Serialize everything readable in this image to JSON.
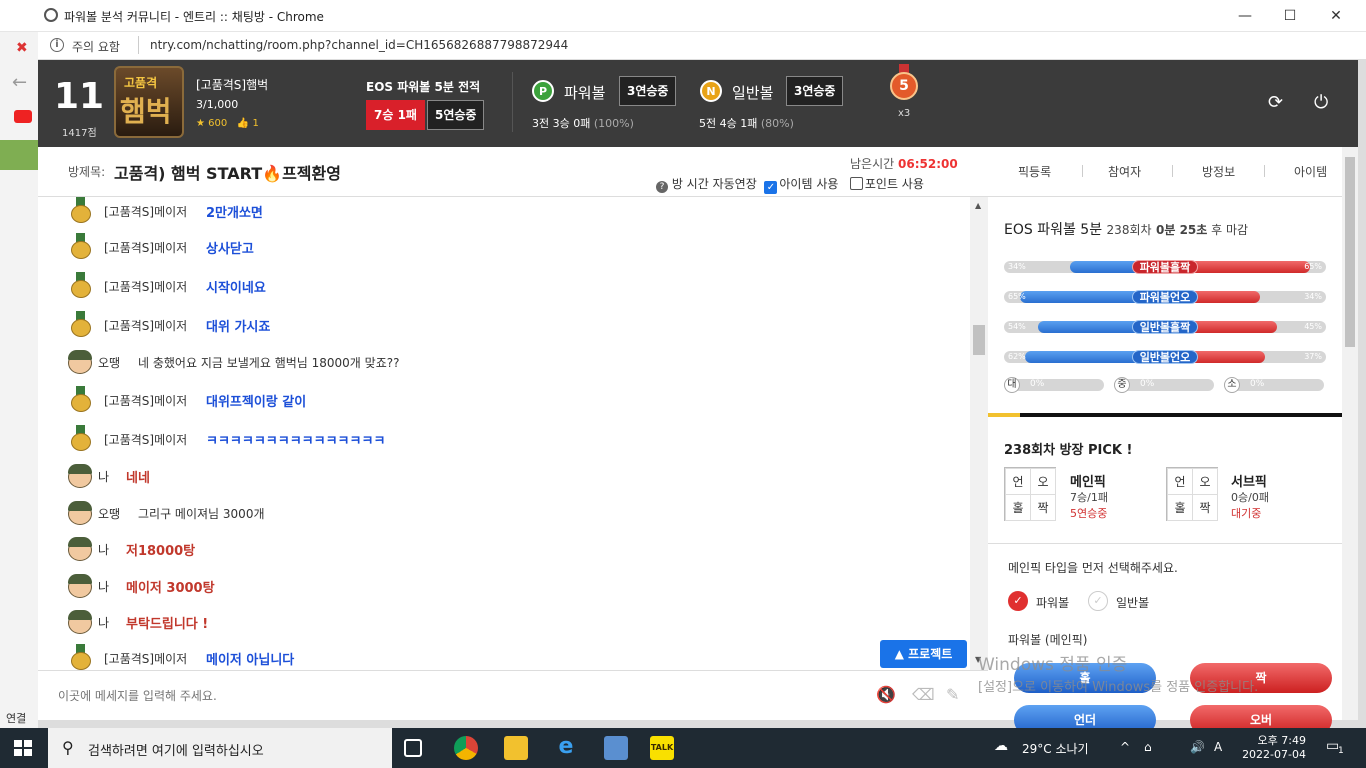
{
  "window": {
    "title": "파워볼 분석 커뮤니티 - 엔트리 :: 채팅방 - Chrome",
    "minimize": "—",
    "maximize": "☐",
    "close": "✕"
  },
  "address": {
    "warning": "주의 요함",
    "url": "ntry.com/nchatting/room.php?channel_id=CH1656826887798872944"
  },
  "left_strip": {
    "connection": "연결 중..."
  },
  "profile": {
    "level": "11",
    "points": "1417점",
    "avatar_top": "고품격",
    "avatar_main": "햄벅",
    "name": "[고품격S]햄벅",
    "rank": "3/1,000",
    "stars": "600",
    "likes": "1"
  },
  "record": {
    "title": "EOS 파워볼 5분 전적",
    "win_loss": "7승 1패",
    "streak": "5연승중"
  },
  "powerball": {
    "icon": "P",
    "label": "파워볼",
    "streak": "3연승중",
    "stat_main": "3전 3승 0패",
    "stat_pct": "(100%)"
  },
  "normalball": {
    "icon": "N",
    "label": "일반볼",
    "streak": "3연승중",
    "stat_main": "5전 4승 1패",
    "stat_pct": "(80%)"
  },
  "medal": {
    "number": "5",
    "multiplier": "x3"
  },
  "room": {
    "label": "방제목:",
    "title": "고품격) 햄벅 START🔥프젝환영",
    "time_label": "남은시간",
    "time_value": "06:52:00",
    "auto_extend": "방 시간 자동연장",
    "item_use": "아이템 사용",
    "point_use": "포인트 사용"
  },
  "tabs": [
    "픽등록",
    "참여자",
    "방정보",
    "아이템"
  ],
  "messages": [
    {
      "avatar": "gold",
      "nick": "[고품격S]메이저",
      "text": "2만개쏘면",
      "style": "blue"
    },
    {
      "avatar": "gold",
      "nick": "[고품격S]메이저",
      "text": "상사닫고",
      "style": "blue"
    },
    {
      "avatar": "gold",
      "nick": "[고품격S]메이저",
      "text": "시작이네요",
      "style": "blue"
    },
    {
      "avatar": "gold",
      "nick": "[고품격S]메이저",
      "text": "대위 가시죠",
      "style": "blue"
    },
    {
      "avatar": "soldier",
      "nick": "오땡",
      "text": "네 충했어요 지금 보낼게요 햄벅님 18000개 맞죠??",
      "style": "plain"
    },
    {
      "avatar": "gold",
      "nick": "[고품격S]메이저",
      "text": "대위프젝이랑 같이",
      "style": "blue"
    },
    {
      "avatar": "gold",
      "nick": "[고품격S]메이저",
      "text": "ㅋㅋㅋㅋㅋㅋㅋㅋㅋㅋㅋㅋㅋㅋㅋ",
      "style": "blue"
    },
    {
      "avatar": "soldier",
      "nick": "나",
      "text": "네네",
      "style": "red"
    },
    {
      "avatar": "soldier",
      "nick": "오땡",
      "text": "그리구 메이져님 3000개",
      "style": "plain"
    },
    {
      "avatar": "soldier",
      "nick": "나",
      "text": "저18000탕",
      "style": "red"
    },
    {
      "avatar": "soldier",
      "nick": "나",
      "text": "메이저 3000탕",
      "style": "red"
    },
    {
      "avatar": "soldier",
      "nick": "나",
      "text": "부탁드립니다 !",
      "style": "red"
    },
    {
      "avatar": "gold",
      "nick": "[고품격S]메이저",
      "text": "메이저 아닙니다",
      "style": "blue"
    }
  ],
  "protect_button": "▲ 프로젝트",
  "chat_input": {
    "placeholder": "이곳에 메세지를 입력해 주세요."
  },
  "side": {
    "game": "EOS 파워볼 5분",
    "round": "238회차",
    "countdown": "0분 25초",
    "countdown_suffix": "후 마감",
    "bars": [
      {
        "label": "파워볼홀짝",
        "left": "34%",
        "right": "65%",
        "left_v": 34,
        "right_v": 65,
        "color": "r"
      },
      {
        "label": "파워볼언오",
        "left": "65%",
        "right": "34%",
        "left_v": 65,
        "right_v": 34,
        "color": "b"
      },
      {
        "label": "일반볼홀짝",
        "left": "54%",
        "right": "45%",
        "left_v": 54,
        "right_v": 45,
        "color": "b"
      },
      {
        "label": "일반볼언오",
        "left": "62%",
        "right": "37%",
        "left_v": 62,
        "right_v": 37,
        "color": "b"
      }
    ],
    "sizes": [
      {
        "label": "대",
        "pct": "0%"
      },
      {
        "label": "중",
        "pct": "0%"
      },
      {
        "label": "소",
        "pct": "0%"
      }
    ],
    "progress": 0.09,
    "pick_title": "238회차 방장 PICK !",
    "main_pick": {
      "cells": [
        "언",
        "오",
        "홀",
        "짝"
      ],
      "name": "메인픽",
      "record": "7승/1패",
      "status": "5연승중"
    },
    "sub_pick": {
      "cells": [
        "언",
        "오",
        "홀",
        "짝"
      ],
      "name": "서브픽",
      "record": "0승/0패",
      "status": "대기중"
    },
    "notice": "메인픽 타입을 먼저 선택해주세요.",
    "radio_powerball": "파워볼",
    "radio_normal": "일반볼",
    "section_label": "파워볼 (메인픽)",
    "btn_odd": "홀",
    "btn_even": "짝",
    "btn_under": "언더",
    "btn_over": "오버"
  },
  "watermark": {
    "line1": "Windows 정품 인증",
    "line2": "[설정]으로 이동하여 Windows를 정품 인증합니다."
  },
  "taskbar": {
    "search_placeholder": "검색하려면 여기에 입력하십시오",
    "weather": "29°C 소나기",
    "time": "오후 7:49",
    "date": "2022-07-04",
    "notif": "1"
  },
  "colors": {
    "accent_blue": "#1c4fd8",
    "accent_red": "#c1382c",
    "topbar": "#3b3b3b"
  }
}
